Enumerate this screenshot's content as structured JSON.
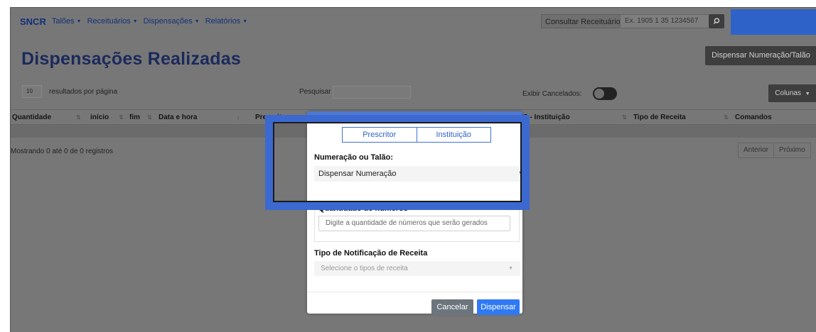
{
  "nav": {
    "brand": "SNCR",
    "items": [
      "Talões",
      "Receituários",
      "Dispensações",
      "Relatórios"
    ],
    "consult_label": "Consultar Receituário:",
    "consult_placeholder": "Ex. 1905 1 35 1234567"
  },
  "page": {
    "title": "Dispensações Realizadas",
    "dispensar_button": "Dispensar Numeração/Talão"
  },
  "table_controls": {
    "per_page_value": "10",
    "per_page_label": "resultados por página",
    "search_label": "Pesquisar",
    "show_cancelled_label": "Exibir Cancelados:",
    "columns_button": "Colunas"
  },
  "table": {
    "headers": [
      "Quantidade",
      "início",
      "fim",
      "Data e hora",
      "Prescritor",
      "CNES - Instituição",
      "Tipo de Receita",
      "Comandos"
    ],
    "info": "Mostrando 0 até 0 de 0 registros",
    "pager": [
      "Anterior",
      "Próximo"
    ]
  },
  "modal": {
    "segments": [
      "Prescritor",
      "Instituição"
    ],
    "numeracao_label": "Numeração ou Talão:",
    "numeracao_value": "Dispensar Numeração",
    "quantidade_label": "Quantidade de números",
    "quantidade_placeholder": "Digite a quantidade de números que serão gerados",
    "tipo_label": "Tipo de Notificação de Receita",
    "tipo_placeholder": "Selecione o tipos de receita",
    "cancel_button": "Cancelar",
    "dispense_button": "Dispensar"
  },
  "colors": {
    "brand": "#12307a",
    "highlight": "#3b69cf",
    "primary": "#2f7af4",
    "secondary": "#6c757d"
  }
}
